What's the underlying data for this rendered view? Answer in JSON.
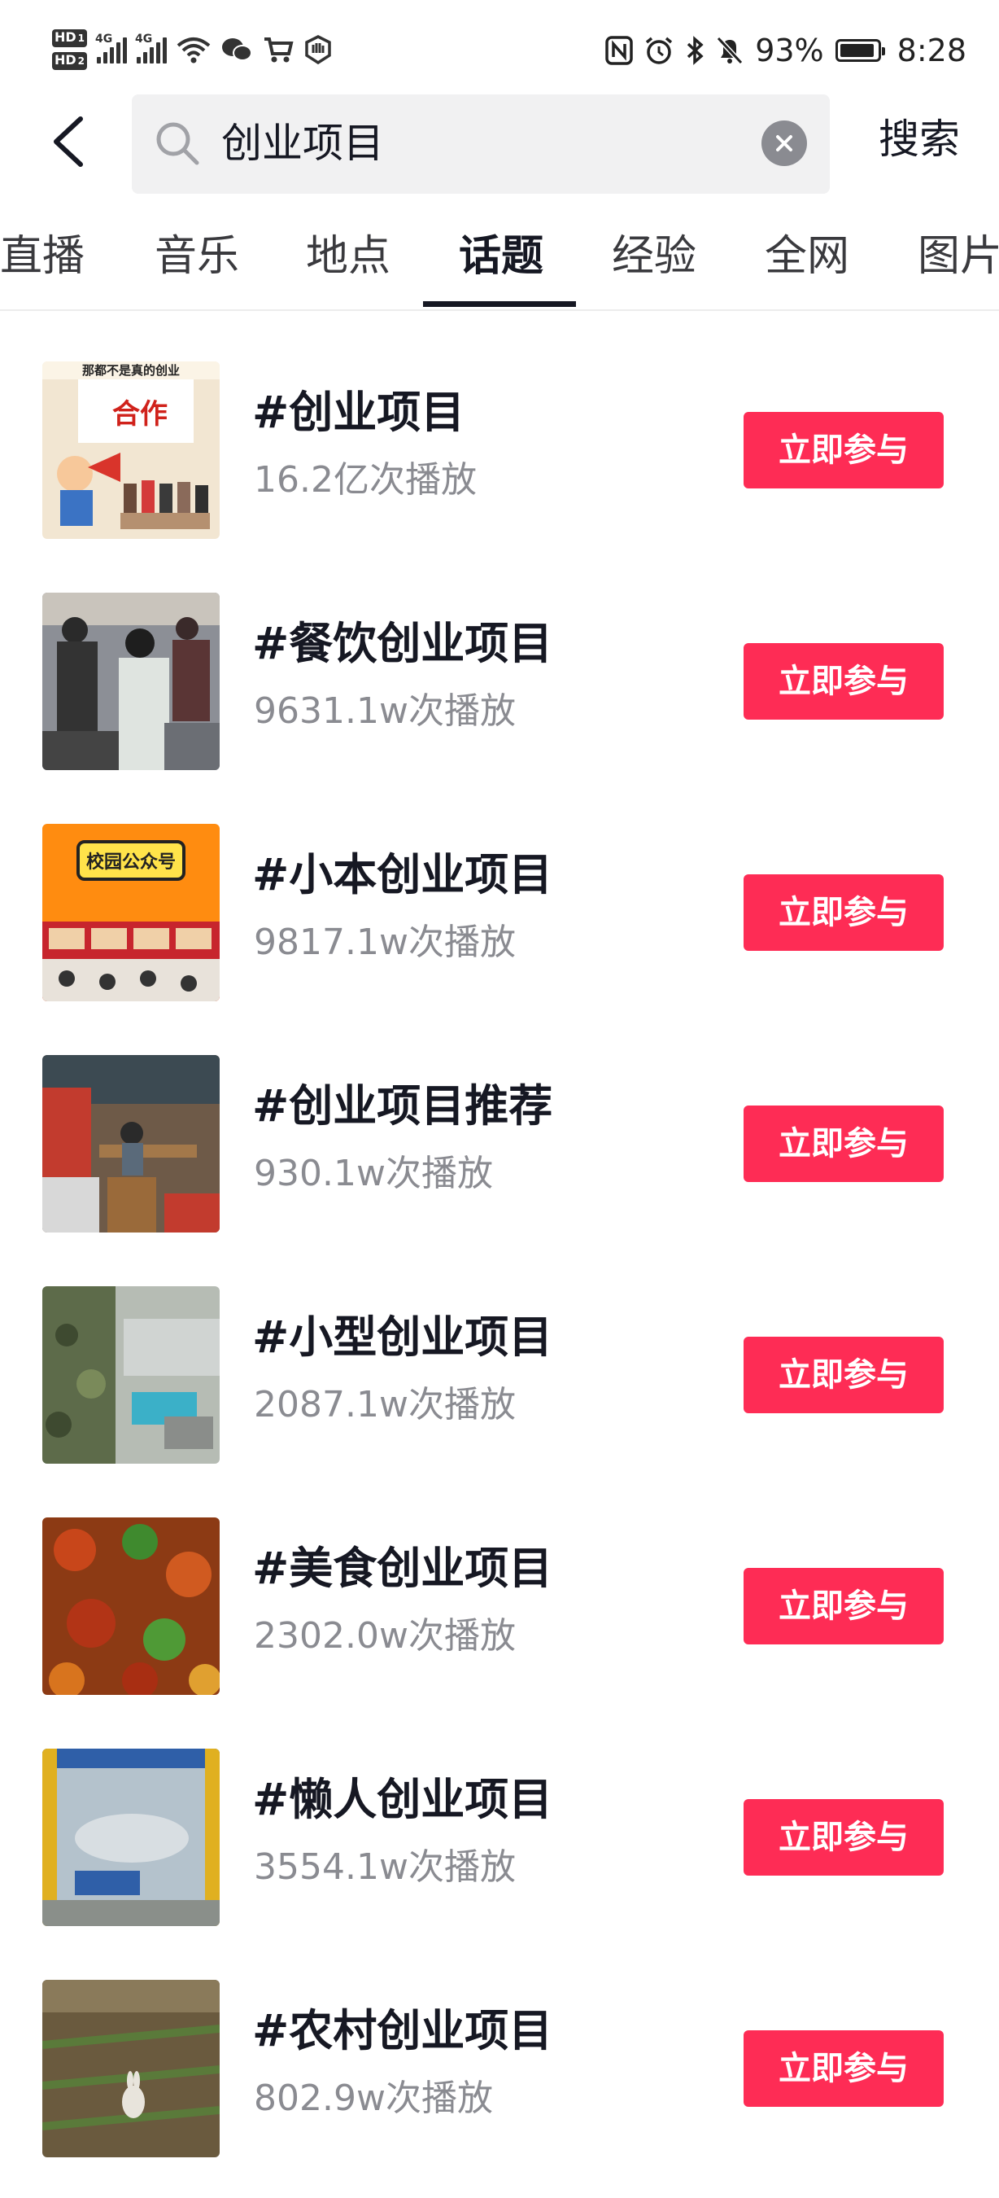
{
  "status_bar": {
    "sim1_label": "HD",
    "sim1_slot": "1",
    "sim2_label": "HD",
    "sim2_slot": "2",
    "network_type": "4G",
    "battery_text": "93%",
    "battery_level": 0.93,
    "time": "8:28"
  },
  "header": {
    "search_value": "创业项目",
    "search_button_label": "搜索"
  },
  "tabs": {
    "items": [
      {
        "label": "直播"
      },
      {
        "label": "音乐"
      },
      {
        "label": "地点"
      },
      {
        "label": "话题"
      },
      {
        "label": "经验"
      },
      {
        "label": "全网"
      },
      {
        "label": "图片"
      }
    ],
    "active": "话题"
  },
  "topics": {
    "join_label": "立即参与",
    "items": [
      {
        "title": "#创业项目",
        "plays": "16.2亿次播放",
        "thumb_text": "那都不是真的创业",
        "thumb_text2": "合作"
      },
      {
        "title": "#餐饮创业项目",
        "plays": "9631.1w次播放"
      },
      {
        "title": "#小本创业项目",
        "plays": "9817.1w次播放",
        "thumb_text": "校园公众号"
      },
      {
        "title": "#创业项目推荐",
        "plays": "930.1w次播放"
      },
      {
        "title": "#小型创业项目",
        "plays": "2087.1w次播放"
      },
      {
        "title": "#美食创业项目",
        "plays": "2302.0w次播放"
      },
      {
        "title": "#懒人创业项目",
        "plays": "3554.1w次播放"
      },
      {
        "title": "#农村创业项目",
        "plays": "802.9w次播放"
      }
    ]
  },
  "colors": {
    "accent": "#fe2c55",
    "text_primary": "#161823",
    "text_secondary": "#8a8b91",
    "search_bg": "#f1f1f2"
  }
}
